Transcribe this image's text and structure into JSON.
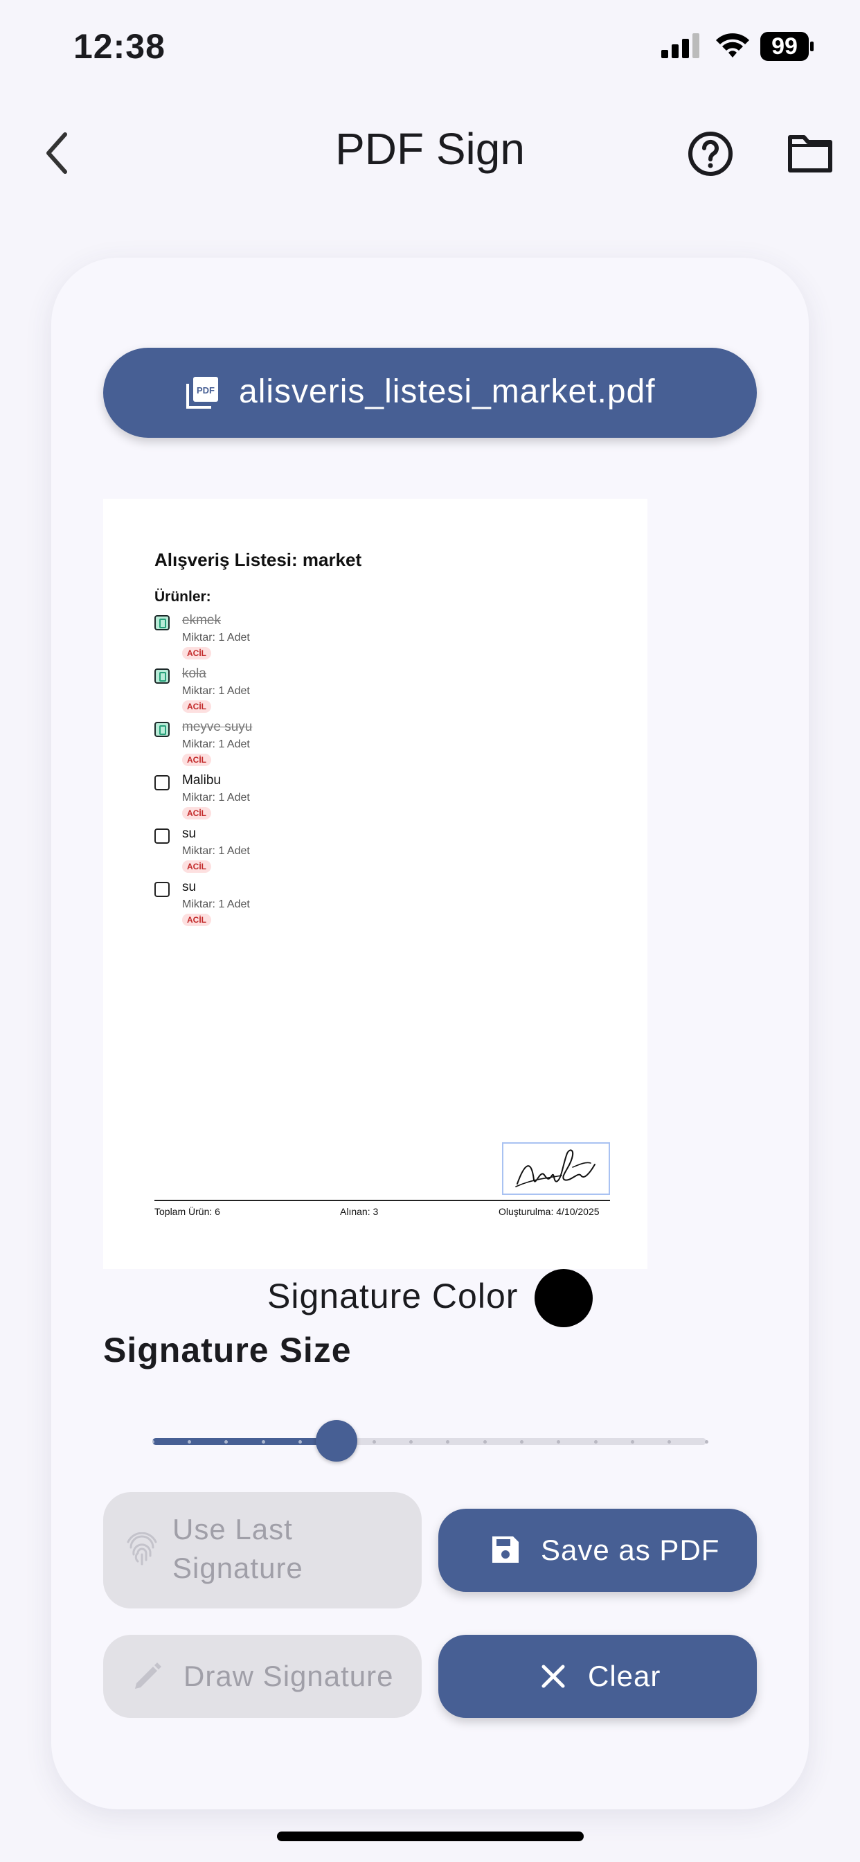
{
  "status_bar": {
    "time": "12:38",
    "battery": "99"
  },
  "app_bar": {
    "title": "PDF Sign",
    "back_icon": "chevron-left-icon",
    "help_icon": "help-circle-icon",
    "folder_icon": "folder-icon"
  },
  "file": {
    "name": "alisveris_listesi_market.pdf",
    "icon": "pdf-file-icon"
  },
  "pdf": {
    "title": "Alışveriş Listesi: market",
    "subtitle": "Ürünler:",
    "items": [
      {
        "name": "ekmek",
        "qty": "Miktar: 1 Adet",
        "badge": "ACİL",
        "done": true
      },
      {
        "name": "kola",
        "qty": "Miktar: 1 Adet",
        "badge": "ACİL",
        "done": true
      },
      {
        "name": "meyve suyu",
        "qty": "Miktar: 1 Adet",
        "badge": "ACİL",
        "done": true
      },
      {
        "name": "Malibu",
        "qty": "Miktar: 1 Adet",
        "badge": "ACİL",
        "done": false
      },
      {
        "name": "su",
        "qty": "Miktar: 1 Adet",
        "badge": "ACİL",
        "done": false
      },
      {
        "name": "su",
        "qty": "Miktar: 1 Adet",
        "badge": "ACİL",
        "done": false
      }
    ],
    "footer": {
      "total": "Toplam Ürün: 6",
      "bought": "Alınan: 3",
      "created": "Oluşturulma: 4/10/2025"
    }
  },
  "signature_color": {
    "label": "Signature Color",
    "value": "#000000"
  },
  "signature_size": {
    "label": "Signature Size",
    "value_fraction": 0.333,
    "divisions": 15
  },
  "buttons": {
    "use_last": {
      "label": "Use Last Signature",
      "line1": "Use Last",
      "line2": "Signature",
      "icon": "fingerprint-icon",
      "enabled": false
    },
    "save": {
      "label": "Save as PDF",
      "icon": "save-icon",
      "enabled": true
    },
    "draw": {
      "label": "Draw Signature",
      "icon": "pencil-icon",
      "enabled": false
    },
    "clear": {
      "label": "Clear",
      "icon": "close-icon",
      "enabled": true
    }
  },
  "colors": {
    "primary": "#475f94",
    "background": "#f6f5fb",
    "disabled": "#e2e1e6"
  }
}
